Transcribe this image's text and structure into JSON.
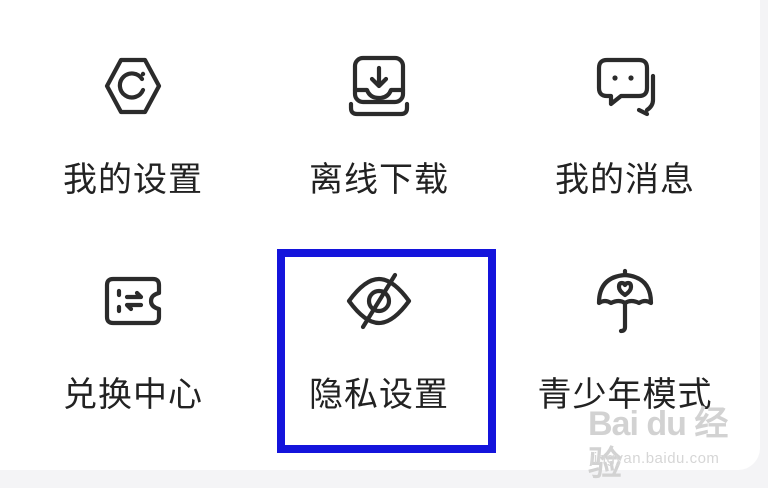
{
  "menu": {
    "items": [
      {
        "label": "我的设置",
        "icon": "gear-icon"
      },
      {
        "label": "离线下载",
        "icon": "download-tray-icon"
      },
      {
        "label": "我的消息",
        "icon": "chat-bubbles-icon"
      },
      {
        "label": "兑换中心",
        "icon": "exchange-ticket-icon"
      },
      {
        "label": "隐私设置",
        "icon": "eye-off-icon"
      },
      {
        "label": "青少年模式",
        "icon": "umbrella-heart-icon"
      }
    ]
  },
  "highlight": {
    "color": "#1414dc",
    "target": "隐私设置"
  },
  "watermark": {
    "brand": "Bai du 经验",
    "url": "jingyan.baidu.com"
  },
  "colors": {
    "icon_stroke": "#2b2b2b",
    "text": "#222222",
    "background": "#ffffff"
  }
}
